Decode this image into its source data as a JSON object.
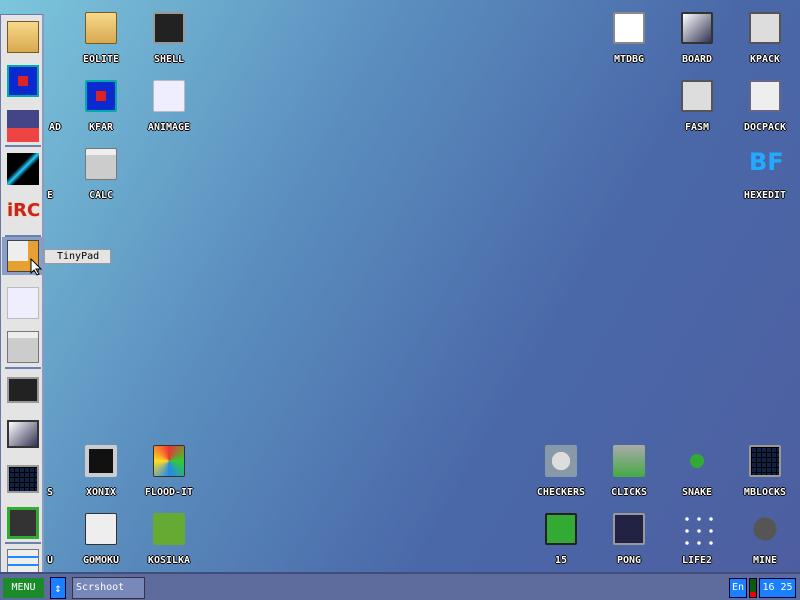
{
  "desktop_icons": [
    {
      "label": "EOLITE",
      "icon": "folder"
    },
    {
      "label": "SHELL",
      "icon": "terminal"
    },
    {
      "label": "KFAR",
      "icon": "kfar"
    },
    {
      "label": "ANIMAGE",
      "icon": "animage"
    },
    {
      "label": "CALC",
      "icon": "calculator"
    },
    {
      "label": "MTDBG",
      "icon": "debugger"
    },
    {
      "label": "BOARD",
      "icon": "windows"
    },
    {
      "label": "KPACK",
      "icon": "pack"
    },
    {
      "label": "FASM",
      "icon": "fasm"
    },
    {
      "label": "DOCPACK",
      "icon": "cabinet"
    },
    {
      "label": "HEXEDIT",
      "icon": "bf-logo"
    },
    {
      "label": "XONIX",
      "icon": "xonix"
    },
    {
      "label": "FLOOD-IT",
      "icon": "cube"
    },
    {
      "label": "GOMOKU",
      "icon": "tic-tac-toe"
    },
    {
      "label": "KOSILKA",
      "icon": "lawnmower"
    },
    {
      "label": "CHECKERS",
      "icon": "checkers"
    },
    {
      "label": "CLICKS",
      "icon": "blocks"
    },
    {
      "label": "SNAKE",
      "icon": "snake"
    },
    {
      "label": "MBLOCKS",
      "icon": "grid"
    },
    {
      "label": "15",
      "icon": "grid-15"
    },
    {
      "label": "PONG",
      "icon": "pong"
    },
    {
      "label": "LIFE2",
      "icon": "dots"
    },
    {
      "label": "MINE",
      "icon": "mine"
    }
  ],
  "covered_labels": [
    "AD",
    "E",
    "S",
    "U"
  ],
  "tooltip": "TinyPad",
  "taskbar": {
    "menu": "MENU",
    "task": "Scrshoot",
    "lang": "En",
    "clock": "16 25",
    "cpu_load_percent": 30
  }
}
